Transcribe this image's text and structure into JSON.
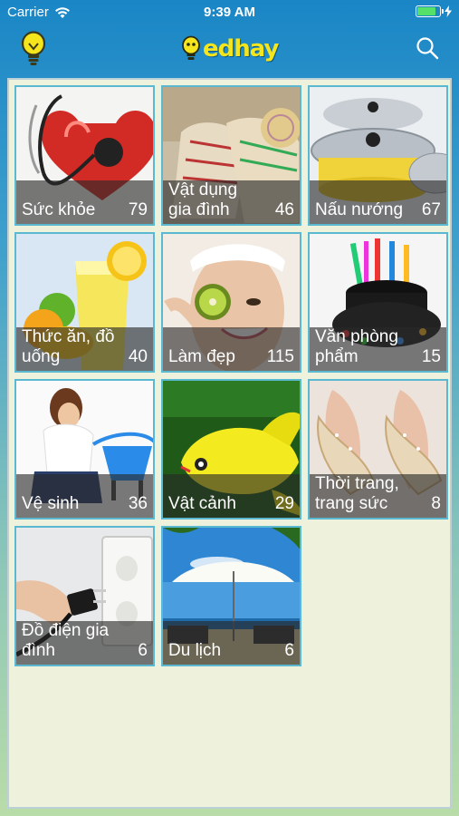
{
  "status_bar": {
    "carrier": "Carrier",
    "time": "9:39 AM",
    "battery_level": 0.85
  },
  "nav": {
    "logo_text": "edhay",
    "left_icon": "lightbulb-icon",
    "right_icon": "search-icon"
  },
  "colors": {
    "accent": "#1a86c6",
    "logo": "#f4e51c",
    "panel": "#eef2dc",
    "tile_border": "#5ab8d0"
  },
  "categories": [
    {
      "label": "Sức khỏe",
      "count": "79",
      "art": "health"
    },
    {
      "label": "Vật dụng gia đình",
      "count": "46",
      "art": "household"
    },
    {
      "label": "Nấu nướng",
      "count": "67",
      "art": "cooking"
    },
    {
      "label": "Thức ăn, đồ uống",
      "count": "40",
      "art": "food"
    },
    {
      "label": "Làm đẹp",
      "count": "115",
      "art": "beauty"
    },
    {
      "label": "Văn phòng phẩm",
      "count": "15",
      "art": "stationery"
    },
    {
      "label": "Vệ sinh",
      "count": "36",
      "art": "cleaning"
    },
    {
      "label": "Vật cảnh",
      "count": "29",
      "art": "pets"
    },
    {
      "label": "Thời trang, trang sức",
      "count": "8",
      "art": "fashion"
    },
    {
      "label": "Đồ điện gia đình",
      "count": "6",
      "art": "electric"
    },
    {
      "label": "Du lịch",
      "count": "6",
      "art": "travel"
    }
  ]
}
